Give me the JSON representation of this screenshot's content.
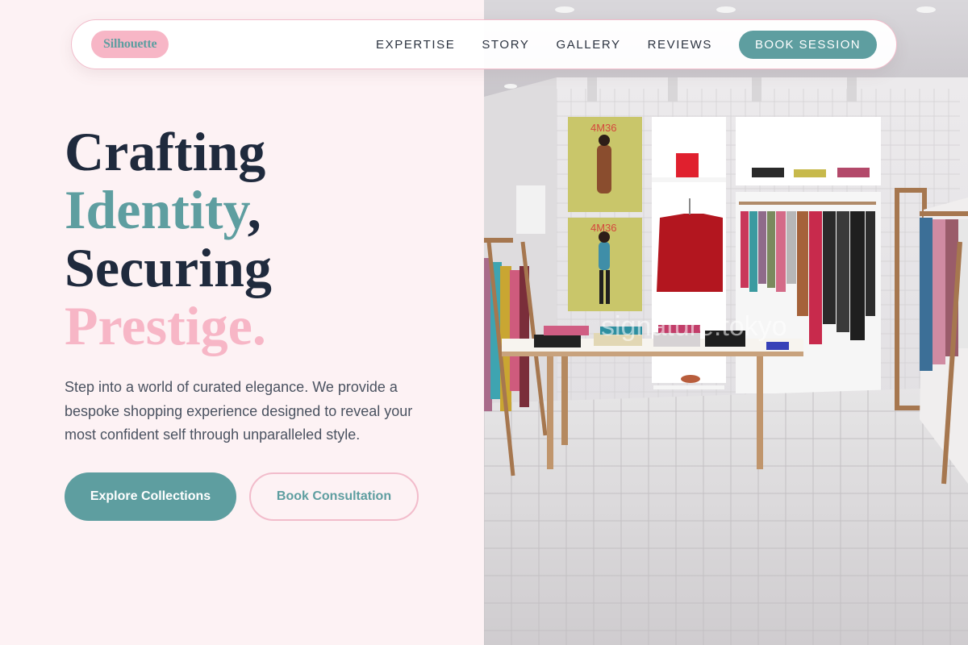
{
  "brand": {
    "logo_text": "Silhouette"
  },
  "nav": {
    "links": [
      "EXPERTISE",
      "STORY",
      "GALLERY",
      "REVIEWS"
    ],
    "cta": "BOOK SESSION"
  },
  "hero": {
    "headline": {
      "line1": "Crafting",
      "line2_accent": "Identity",
      "line2_rest": ",",
      "line3": "Securing",
      "line4_accent": "Prestige."
    },
    "subtext": "Step into a world of curated elegance. We provide a bespoke shopping experience designed to reveal your most confident self through unparalleled style.",
    "primary_button": "Explore Collections",
    "secondary_button": "Book Consultation"
  },
  "photo": {
    "poster_text_1": "4M36",
    "poster_text_2": "4M36",
    "watermark": "signature.tokyo"
  },
  "colors": {
    "accent_teal": "#5e9ea0",
    "accent_pink": "#f7b6c6",
    "background": "#fdf2f4",
    "heading": "#1f2a3d"
  }
}
